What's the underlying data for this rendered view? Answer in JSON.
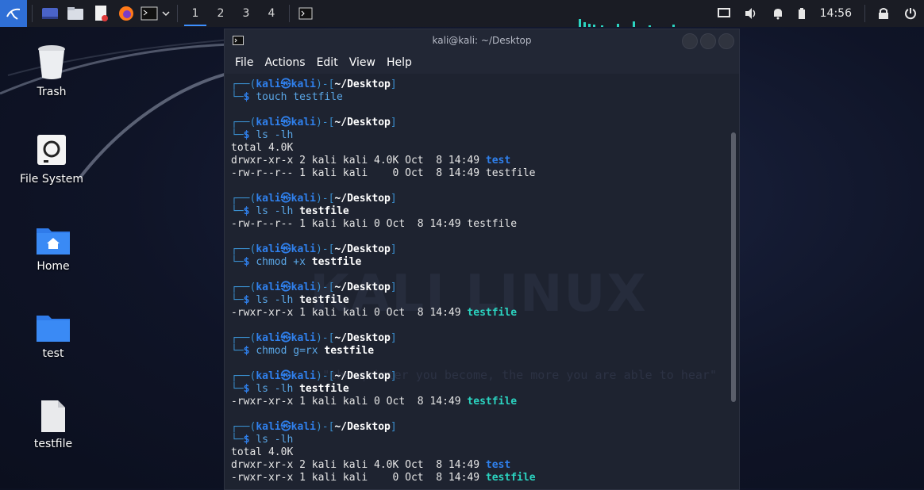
{
  "taskbar": {
    "workspaces": [
      "1",
      "2",
      "3",
      "4"
    ],
    "clock": "14:56"
  },
  "desktop": {
    "icons": [
      {
        "label": "Trash"
      },
      {
        "label": "File System"
      },
      {
        "label": "Home"
      },
      {
        "label": "test"
      },
      {
        "label": "testfile"
      }
    ]
  },
  "terminal": {
    "title": "kali@kali: ~/Desktop",
    "menu": [
      "File",
      "Actions",
      "Edit",
      "View",
      "Help"
    ],
    "watermark": "KALI LINUX",
    "tagline": "\"the quieter you become, the more you are able to hear\"",
    "prompt": {
      "user": "kali",
      "at": "㉿",
      "host": "kali",
      "cwd": "~/Desktop"
    },
    "lines": [
      {
        "kind": "prompt"
      },
      {
        "kind": "cmd",
        "cmd": "touch",
        "args": " testfile",
        "bold": ""
      },
      {
        "kind": "blank"
      },
      {
        "kind": "prompt"
      },
      {
        "kind": "cmd",
        "cmd": "ls",
        "args": " -lh",
        "bold": ""
      },
      {
        "kind": "out",
        "text": "total 4.0K",
        "hl": "",
        "hlclass": ""
      },
      {
        "kind": "out",
        "text": "drwxr-xr-x 2 kali kali 4.0K Oct  8 14:49 ",
        "hl": "test",
        "hlclass": "blue"
      },
      {
        "kind": "out",
        "text": "-rw-r--r-- 1 kali kali    0 Oct  8 14:49 testfile",
        "hl": "",
        "hlclass": ""
      },
      {
        "kind": "blank"
      },
      {
        "kind": "prompt"
      },
      {
        "kind": "cmd",
        "cmd": "ls",
        "args": " -lh ",
        "bold": "testfile"
      },
      {
        "kind": "out",
        "text": "-rw-r--r-- 1 kali kali 0 Oct  8 14:49 testfile",
        "hl": "",
        "hlclass": ""
      },
      {
        "kind": "blank"
      },
      {
        "kind": "prompt"
      },
      {
        "kind": "cmd",
        "cmd": "chmod",
        "args": " +x ",
        "bold": "testfile"
      },
      {
        "kind": "blank"
      },
      {
        "kind": "prompt"
      },
      {
        "kind": "cmd",
        "cmd": "ls",
        "args": " -lh ",
        "bold": "testfile"
      },
      {
        "kind": "out",
        "text": "-rwxr-xr-x 1 kali kali 0 Oct  8 14:49 ",
        "hl": "testfile",
        "hlclass": "cyan"
      },
      {
        "kind": "blank"
      },
      {
        "kind": "prompt"
      },
      {
        "kind": "cmd",
        "cmd": "chmod",
        "args": " g=rx ",
        "bold": "testfile"
      },
      {
        "kind": "blank"
      },
      {
        "kind": "prompt"
      },
      {
        "kind": "cmd",
        "cmd": "ls",
        "args": " -lh ",
        "bold": "testfile"
      },
      {
        "kind": "out",
        "text": "-rwxr-xr-x 1 kali kali 0 Oct  8 14:49 ",
        "hl": "testfile",
        "hlclass": "cyan"
      },
      {
        "kind": "blank"
      },
      {
        "kind": "prompt"
      },
      {
        "kind": "cmd",
        "cmd": "ls",
        "args": " -lh",
        "bold": ""
      },
      {
        "kind": "out",
        "text": "total 4.0K",
        "hl": "",
        "hlclass": ""
      },
      {
        "kind": "out",
        "text": "drwxr-xr-x 2 kali kali 4.0K Oct  8 14:49 ",
        "hl": "test",
        "hlclass": "blue"
      },
      {
        "kind": "out",
        "text": "-rwxr-xr-x 1 kali kali    0 Oct  8 14:49 ",
        "hl": "testfile",
        "hlclass": "cyan"
      }
    ]
  }
}
